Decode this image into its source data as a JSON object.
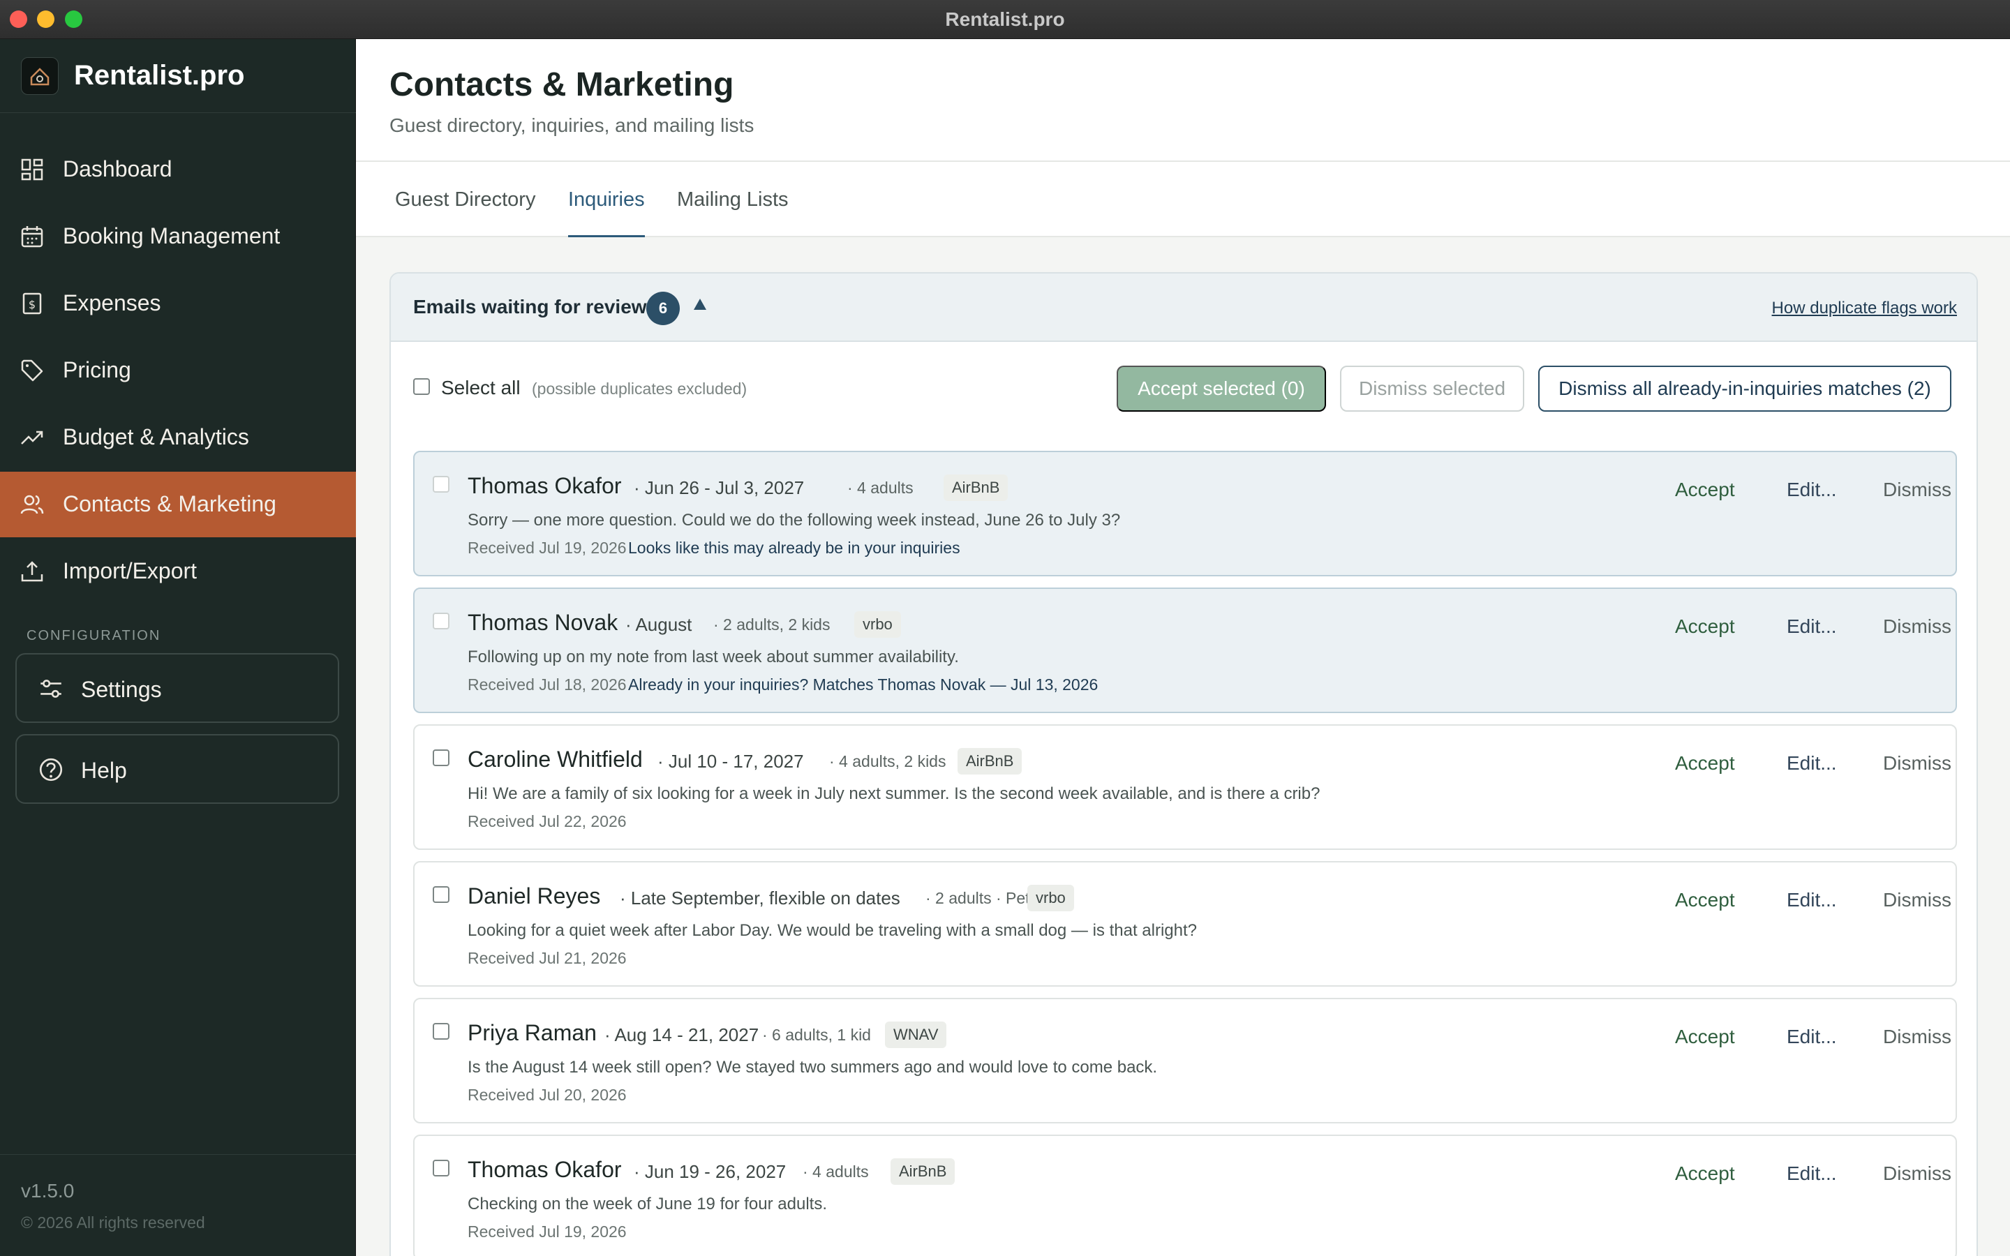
{
  "window": {
    "title": "Rentalist.pro"
  },
  "sidebar": {
    "brand": "Rentalist.pro",
    "items": [
      {
        "label": "Dashboard",
        "icon": "dashboard-icon"
      },
      {
        "label": "Booking Management",
        "icon": "calendar-icon"
      },
      {
        "label": "Expenses",
        "icon": "receipt-icon"
      },
      {
        "label": "Pricing",
        "icon": "tag-icon"
      },
      {
        "label": "Budget & Analytics",
        "icon": "trend-icon"
      },
      {
        "label": "Contacts & Marketing",
        "icon": "users-icon",
        "active": true
      },
      {
        "label": "Import/Export",
        "icon": "upload-icon"
      }
    ],
    "config_label": "CONFIGURATION",
    "settings_label": "Settings",
    "help_label": "Help",
    "version": "v1.5.0",
    "copyright": "© 2026 All rights reserved"
  },
  "page": {
    "title": "Contacts & Marketing",
    "subtitle": "Guest directory, inquiries, and mailing lists"
  },
  "tabs": [
    {
      "label": "Guest Directory"
    },
    {
      "label": "Inquiries",
      "active": true
    },
    {
      "label": "Mailing Lists"
    }
  ],
  "review": {
    "title": "Emails waiting for review",
    "count": "6",
    "help_link": "How duplicate flags work",
    "select_all": "Select all",
    "select_note": "(possible duplicates excluded)",
    "accept_selected": "Accept selected (0)",
    "dismiss_selected": "Dismiss selected",
    "dismiss_all": "Dismiss all already-in-inquiries matches (2)"
  },
  "actions": {
    "accept": "Accept",
    "edit": "Edit...",
    "dismiss": "Dismiss"
  },
  "inquiries": [
    {
      "name": "Thomas Okafor",
      "dates": "· Jun 26 - Jul 3, 2027",
      "guests": "· 4 adults",
      "source": "AirBnB",
      "message": "Sorry — one more question. Could we do the following week instead, June 26 to July 3?",
      "received": "Received Jul 19, 2026",
      "flag": "Looks like this may already be in your inquiries"
    },
    {
      "name": "Thomas Novak",
      "dates": "· August",
      "guests": "· 2 adults, 2 kids",
      "source": "vrbo",
      "message": "Following up on my note from last week about summer availability.",
      "received": "Received Jul 18, 2026",
      "flag": "Already in your inquiries? Matches Thomas Novak — Jul 13, 2026"
    },
    {
      "name": "Caroline Whitfield",
      "dates": "· Jul 10 - 17, 2027",
      "guests": "· 4 adults, 2 kids",
      "source": "AirBnB",
      "message": "Hi! We are a family of six looking for a week in July next summer. Is the second week available, and is there a crib?",
      "received": "Received Jul 22, 2026",
      "flag": ""
    },
    {
      "name": "Daniel Reyes",
      "dates": "· Late September, flexible on dates",
      "guests": "· 2 adults · Pet",
      "source": "vrbo",
      "message": "Looking for a quiet week after Labor Day. We would be traveling with a small dog — is that alright?",
      "received": "Received Jul 21, 2026",
      "flag": ""
    },
    {
      "name": "Priya Raman",
      "dates": "· Aug 14 - 21, 2027",
      "guests": "· 6 adults, 1 kid",
      "source": "WNAV",
      "message": "Is the August 14 week still open? We stayed two summers ago and would love to come back.",
      "received": "Received Jul 20, 2026",
      "flag": ""
    },
    {
      "name": "Thomas Okafor",
      "dates": "· Jun 19 - 26, 2027",
      "guests": "· 4 adults",
      "source": "AirBnB",
      "message": "Checking on the week of June 19 for four adults.",
      "received": "Received Jul 19, 2026",
      "flag": ""
    }
  ]
}
